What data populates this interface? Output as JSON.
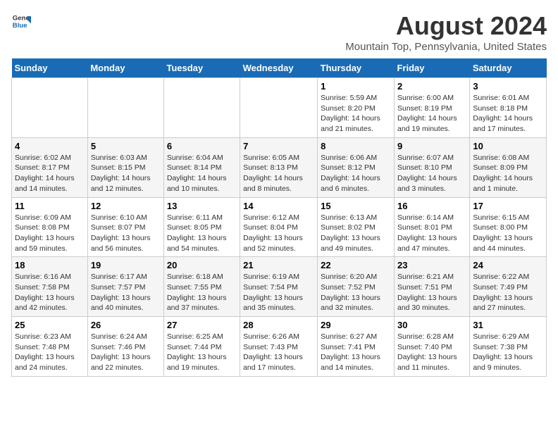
{
  "header": {
    "logo_line1": "General",
    "logo_line2": "Blue",
    "title": "August 2024",
    "subtitle": "Mountain Top, Pennsylvania, United States"
  },
  "weekdays": [
    "Sunday",
    "Monday",
    "Tuesday",
    "Wednesday",
    "Thursday",
    "Friday",
    "Saturday"
  ],
  "weeks": [
    [
      {
        "day": "",
        "detail": ""
      },
      {
        "day": "",
        "detail": ""
      },
      {
        "day": "",
        "detail": ""
      },
      {
        "day": "",
        "detail": ""
      },
      {
        "day": "1",
        "detail": "Sunrise: 5:59 AM\nSunset: 8:20 PM\nDaylight: 14 hours and 21 minutes."
      },
      {
        "day": "2",
        "detail": "Sunrise: 6:00 AM\nSunset: 8:19 PM\nDaylight: 14 hours and 19 minutes."
      },
      {
        "day": "3",
        "detail": "Sunrise: 6:01 AM\nSunset: 8:18 PM\nDaylight: 14 hours and 17 minutes."
      }
    ],
    [
      {
        "day": "4",
        "detail": "Sunrise: 6:02 AM\nSunset: 8:17 PM\nDaylight: 14 hours and 14 minutes."
      },
      {
        "day": "5",
        "detail": "Sunrise: 6:03 AM\nSunset: 8:15 PM\nDaylight: 14 hours and 12 minutes."
      },
      {
        "day": "6",
        "detail": "Sunrise: 6:04 AM\nSunset: 8:14 PM\nDaylight: 14 hours and 10 minutes."
      },
      {
        "day": "7",
        "detail": "Sunrise: 6:05 AM\nSunset: 8:13 PM\nDaylight: 14 hours and 8 minutes."
      },
      {
        "day": "8",
        "detail": "Sunrise: 6:06 AM\nSunset: 8:12 PM\nDaylight: 14 hours and 6 minutes."
      },
      {
        "day": "9",
        "detail": "Sunrise: 6:07 AM\nSunset: 8:10 PM\nDaylight: 14 hours and 3 minutes."
      },
      {
        "day": "10",
        "detail": "Sunrise: 6:08 AM\nSunset: 8:09 PM\nDaylight: 14 hours and 1 minute."
      }
    ],
    [
      {
        "day": "11",
        "detail": "Sunrise: 6:09 AM\nSunset: 8:08 PM\nDaylight: 13 hours and 59 minutes."
      },
      {
        "day": "12",
        "detail": "Sunrise: 6:10 AM\nSunset: 8:07 PM\nDaylight: 13 hours and 56 minutes."
      },
      {
        "day": "13",
        "detail": "Sunrise: 6:11 AM\nSunset: 8:05 PM\nDaylight: 13 hours and 54 minutes."
      },
      {
        "day": "14",
        "detail": "Sunrise: 6:12 AM\nSunset: 8:04 PM\nDaylight: 13 hours and 52 minutes."
      },
      {
        "day": "15",
        "detail": "Sunrise: 6:13 AM\nSunset: 8:02 PM\nDaylight: 13 hours and 49 minutes."
      },
      {
        "day": "16",
        "detail": "Sunrise: 6:14 AM\nSunset: 8:01 PM\nDaylight: 13 hours and 47 minutes."
      },
      {
        "day": "17",
        "detail": "Sunrise: 6:15 AM\nSunset: 8:00 PM\nDaylight: 13 hours and 44 minutes."
      }
    ],
    [
      {
        "day": "18",
        "detail": "Sunrise: 6:16 AM\nSunset: 7:58 PM\nDaylight: 13 hours and 42 minutes."
      },
      {
        "day": "19",
        "detail": "Sunrise: 6:17 AM\nSunset: 7:57 PM\nDaylight: 13 hours and 40 minutes."
      },
      {
        "day": "20",
        "detail": "Sunrise: 6:18 AM\nSunset: 7:55 PM\nDaylight: 13 hours and 37 minutes."
      },
      {
        "day": "21",
        "detail": "Sunrise: 6:19 AM\nSunset: 7:54 PM\nDaylight: 13 hours and 35 minutes."
      },
      {
        "day": "22",
        "detail": "Sunrise: 6:20 AM\nSunset: 7:52 PM\nDaylight: 13 hours and 32 minutes."
      },
      {
        "day": "23",
        "detail": "Sunrise: 6:21 AM\nSunset: 7:51 PM\nDaylight: 13 hours and 30 minutes."
      },
      {
        "day": "24",
        "detail": "Sunrise: 6:22 AM\nSunset: 7:49 PM\nDaylight: 13 hours and 27 minutes."
      }
    ],
    [
      {
        "day": "25",
        "detail": "Sunrise: 6:23 AM\nSunset: 7:48 PM\nDaylight: 13 hours and 24 minutes."
      },
      {
        "day": "26",
        "detail": "Sunrise: 6:24 AM\nSunset: 7:46 PM\nDaylight: 13 hours and 22 minutes."
      },
      {
        "day": "27",
        "detail": "Sunrise: 6:25 AM\nSunset: 7:44 PM\nDaylight: 13 hours and 19 minutes."
      },
      {
        "day": "28",
        "detail": "Sunrise: 6:26 AM\nSunset: 7:43 PM\nDaylight: 13 hours and 17 minutes."
      },
      {
        "day": "29",
        "detail": "Sunrise: 6:27 AM\nSunset: 7:41 PM\nDaylight: 13 hours and 14 minutes."
      },
      {
        "day": "30",
        "detail": "Sunrise: 6:28 AM\nSunset: 7:40 PM\nDaylight: 13 hours and 11 minutes."
      },
      {
        "day": "31",
        "detail": "Sunrise: 6:29 AM\nSunset: 7:38 PM\nDaylight: 13 hours and 9 minutes."
      }
    ]
  ]
}
